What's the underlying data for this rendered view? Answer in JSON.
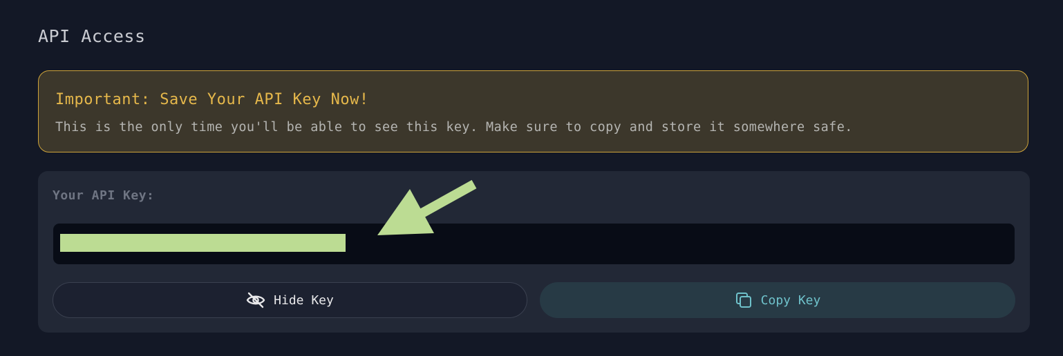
{
  "section": {
    "title": "API Access"
  },
  "warning": {
    "title": "Important: Save Your API Key Now!",
    "message": "This is the only time you'll be able to see this key. Make sure to copy and store it somewhere safe."
  },
  "api_key": {
    "label": "Your API Key:",
    "value": ""
  },
  "buttons": {
    "hide_label": "Hide Key",
    "hide_icon": "eye-off-icon",
    "copy_label": "Copy Key",
    "copy_icon": "copy-icon"
  },
  "annotation": {
    "redaction_color": "#bcdc93",
    "arrow_color": "#bcdc93"
  },
  "colors": {
    "background": "#131826",
    "warning_border": "#cfa43a",
    "warning_title": "#e6b84b",
    "panel": "#222836",
    "copy_accent": "#6fc2cb"
  }
}
